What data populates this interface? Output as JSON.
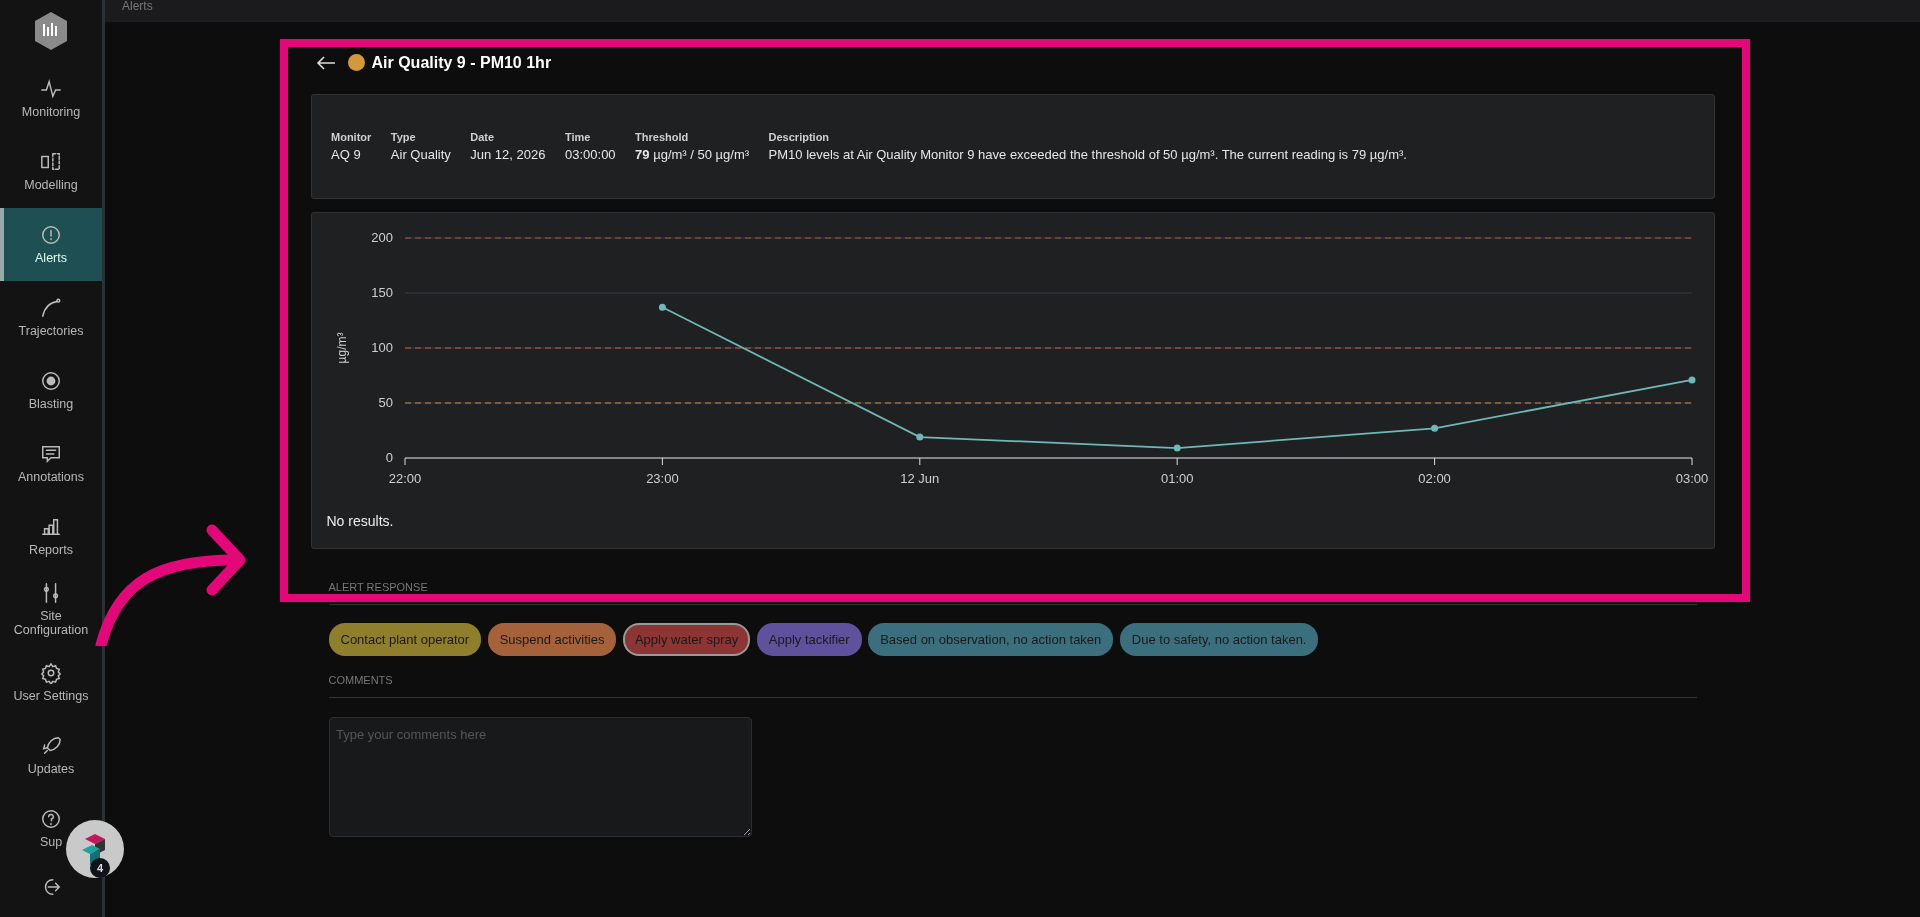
{
  "breadcrumb": "Alerts",
  "sidebar": {
    "items": [
      {
        "label": "Monitoring",
        "selected": false
      },
      {
        "label": "Modelling",
        "selected": false
      },
      {
        "label": "Alerts",
        "selected": true
      },
      {
        "label": "Trajectories",
        "selected": false
      },
      {
        "label": "Blasting",
        "selected": false
      },
      {
        "label": "Annotations",
        "selected": false
      },
      {
        "label": "Reports",
        "selected": false
      },
      {
        "label": "Site Configuration",
        "selected": false
      },
      {
        "label": "User Settings",
        "selected": false
      },
      {
        "label": "Updates",
        "selected": false
      },
      {
        "label": "Sup",
        "selected": false
      },
      {
        "selected": false
      }
    ]
  },
  "chat_bubble": {
    "badge": "4"
  },
  "alert": {
    "title": "Air Quality 9 - PM10 1hr",
    "color": "#d4973a"
  },
  "details": [
    {
      "label": "Monitor",
      "value": "AQ 9"
    },
    {
      "label": "Type",
      "value": "Air Quality"
    },
    {
      "label": "Date",
      "value": "Jun 12, 2026"
    },
    {
      "label": "Time",
      "value": "03:00:00"
    },
    {
      "label": "Threshold",
      "value": "**79** µg/m³ / 50 µg/m³"
    },
    {
      "label": "Description",
      "value": "PM10 levels at Air Quality Monitor 9 have exceeded the threshold of 50 µg/m³. The current reading is 79 µg/m³."
    }
  ],
  "chart": {
    "chart_data": {
      "type": "line",
      "ylabel": "µg/m³",
      "categories": [
        "22:00",
        "23:00",
        "12 Jun",
        "01:00",
        "02:00",
        "03:00"
      ],
      "series": [
        {
          "color": "#6fb8b8",
          "marker": "circle",
          "values": [
            null,
            137,
            19,
            9,
            27,
            71
          ]
        }
      ],
      "ylim": [
        0,
        200
      ],
      "yticks": [
        0,
        50,
        100,
        150,
        200
      ],
      "grid": true,
      "ref_lines": [
        {
          "axis": "y",
          "value": 200,
          "color": "#b5533f"
        },
        {
          "axis": "y",
          "value": 100,
          "color": "#c2603c"
        },
        {
          "axis": "y",
          "value": 50,
          "color": "#c98a3a"
        }
      ]
    },
    "empty_text": "No results."
  },
  "response": {
    "heading": "ALERT RESPONSE",
    "options": [
      {
        "label": "Contact plant operator",
        "color": "#8f7f2c",
        "selected": false
      },
      {
        "label": "Suspend activities",
        "color": "#a5623a",
        "selected": false
      },
      {
        "label": "Apply water spray",
        "color": "#8d3535",
        "selected": true
      },
      {
        "label": "Apply tackifier",
        "color": "#5f519c",
        "selected": false
      },
      {
        "label": "Based on observation, no action taken",
        "color": "#3b6f7e",
        "selected": false
      },
      {
        "label": "Due to safety, no action taken.",
        "color": "#3b6f7e",
        "selected": false
      }
    ]
  },
  "comments": {
    "heading": "COMMENTS",
    "placeholder": "Type your comments here"
  }
}
